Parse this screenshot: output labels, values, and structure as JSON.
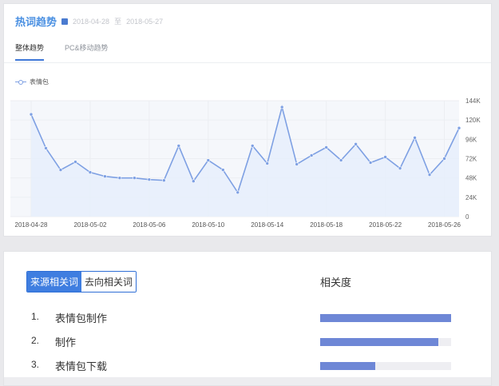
{
  "header": {
    "title": "热词趋势",
    "date_start": "2018-04-28",
    "date_sep": "至",
    "date_end": "2018-05-27"
  },
  "tabs": [
    {
      "label": "整体趋势",
      "active": true
    },
    {
      "label": "PC&移动趋势",
      "active": false
    }
  ],
  "colors": {
    "accent": "#3f7ee0",
    "line": "#7ea0e3",
    "area": "#e6eefc",
    "bar": "#6e87d6"
  },
  "chart_data": {
    "type": "area",
    "legend": "表情包",
    "legend_position": "top-left",
    "x": [
      "2018-04-28",
      "2018-04-29",
      "2018-04-30",
      "2018-05-01",
      "2018-05-02",
      "2018-05-03",
      "2018-05-04",
      "2018-05-05",
      "2018-05-06",
      "2018-05-07",
      "2018-05-08",
      "2018-05-09",
      "2018-05-10",
      "2018-05-11",
      "2018-05-12",
      "2018-05-13",
      "2018-05-14",
      "2018-05-15",
      "2018-05-16",
      "2018-05-17",
      "2018-05-18",
      "2018-05-19",
      "2018-05-20",
      "2018-05-21",
      "2018-05-22",
      "2018-05-23",
      "2018-05-24",
      "2018-05-25",
      "2018-05-26",
      "2018-05-27"
    ],
    "x_tick_labels": [
      "2018-04-28",
      "2018-05-02",
      "2018-05-06",
      "2018-05-10",
      "2018-05-14",
      "2018-05-18",
      "2018-05-22",
      "2018-05-26"
    ],
    "x_tick_indices": [
      0,
      4,
      8,
      12,
      16,
      20,
      24,
      28
    ],
    "series": [
      {
        "name": "表情包",
        "values": [
          127000,
          85000,
          58000,
          68000,
          55000,
          50000,
          48000,
          48000,
          46000,
          45000,
          88000,
          44000,
          70000,
          58000,
          30000,
          88000,
          66000,
          136000,
          65000,
          76000,
          86000,
          70000,
          90000,
          67000,
          74000,
          60000,
          98000,
          52000,
          72000,
          110000
        ]
      }
    ],
    "y_tick_labels": [
      "0",
      "24K",
      "48K",
      "72K",
      "96K",
      "120K",
      "144K"
    ],
    "y_ticks": [
      0,
      24000,
      48000,
      72000,
      96000,
      120000,
      144000
    ],
    "ylim": [
      0,
      144000
    ],
    "y_axis_side": "right",
    "grid": true
  },
  "related": {
    "segments": [
      {
        "label": "来源相关词",
        "active": true
      },
      {
        "label": "去向相关词",
        "active": false
      }
    ],
    "correlation_header": "相关度",
    "items": [
      {
        "index": "1.",
        "label": "表情包制作",
        "relevance": 1.0
      },
      {
        "index": "2.",
        "label": "制作",
        "relevance": 0.9
      },
      {
        "index": "3.",
        "label": "表情包下载",
        "relevance": 0.42
      }
    ]
  }
}
